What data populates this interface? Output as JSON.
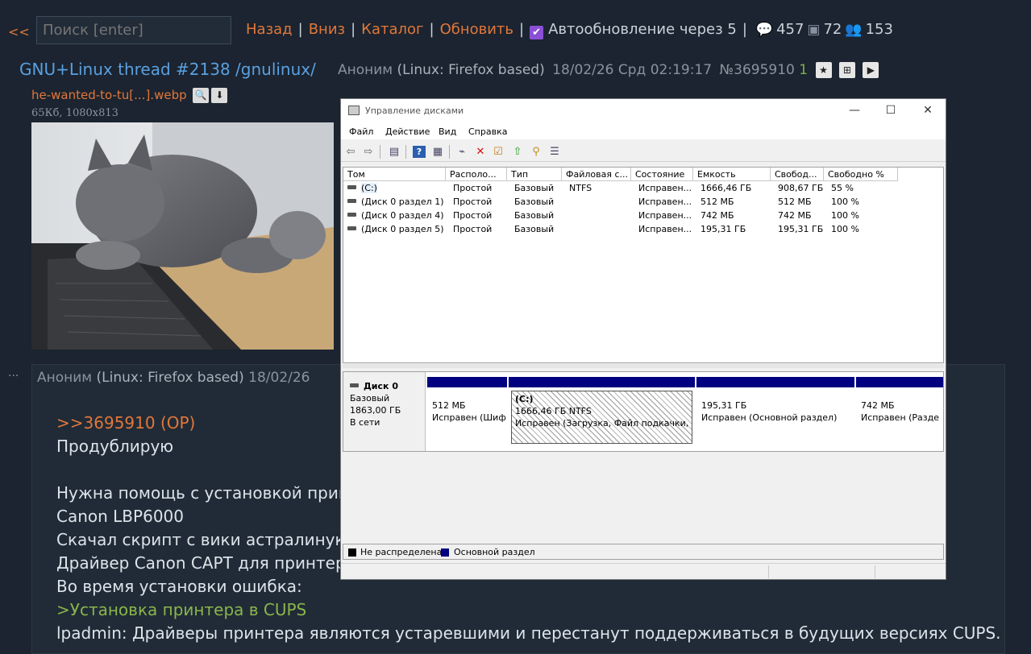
{
  "topbar": {
    "back": "<<",
    "search_placeholder": "Поиск [enter]",
    "links": [
      "Назад",
      "Вниз",
      "Каталог",
      "Обновить"
    ],
    "separator": "|",
    "autoupdate_label": "Автообновление через 5",
    "autoupdate_checked": true,
    "stats": {
      "posts": "457",
      "images": "72",
      "posters": "153"
    }
  },
  "post": {
    "title": "GNU+Linux thread #2138 /gnulinux/",
    "author": "Аноним",
    "os": "(Linux: Firefox based)",
    "date": "18/02/26 Срд 02:19:17",
    "number": "№3695910",
    "replies": "1",
    "file": {
      "name": "he-wanted-to-tu[...].webp",
      "info": "65Кб, 1080x813"
    }
  },
  "reply": {
    "dots": "...",
    "author": "Аноним",
    "os": "(Linux: Firefox based)",
    "date": "18/02/26",
    "lines": [
      {
        "text": ">>3695910 (OP)",
        "kind": "quote"
      },
      {
        "text": "Продублирую",
        "kind": "text"
      },
      {
        "text": "",
        "kind": "text"
      },
      {
        "text": "Нужна помощь с установкой прин",
        "kind": "text"
      },
      {
        "text": "Canon LBP6000",
        "kind": "text"
      },
      {
        "text": "Скачал скрипт с вики астралинукс",
        "kind": "text"
      },
      {
        "text": "Драйвер Canon CAPT для принтер",
        "kind": "text"
      },
      {
        "text": "Во время установки ошибка:",
        "kind": "text"
      },
      {
        "text": ">Установка принтера в CUPS",
        "kind": "green"
      },
      {
        "text": "lpadmin: Драйверы принтера являются устаревшими и перестанут поддерживаться в будущих версиях CUPS.",
        "kind": "text"
      }
    ]
  },
  "window": {
    "title": "Управление дисками",
    "menu": [
      "Файл",
      "Действие",
      "Вид",
      "Справка"
    ],
    "columns": [
      "Том",
      "Располо...",
      "Тип",
      "Файловая с...",
      "Состояние",
      "Емкость",
      "Свобод...",
      "Свободно %"
    ],
    "volumes": [
      [
        "(C:)",
        "Простой",
        "Базовый",
        "NTFS",
        "Исправен...",
        "1666,46 ГБ",
        "908,67 ГБ",
        "55 %"
      ],
      [
        "(Диск 0 раздел 1)",
        "Простой",
        "Базовый",
        "",
        "Исправен...",
        "512 МБ",
        "512 МБ",
        "100 %"
      ],
      [
        "(Диск 0 раздел 4)",
        "Простой",
        "Базовый",
        "",
        "Исправен...",
        "742 МБ",
        "742 МБ",
        "100 %"
      ],
      [
        "(Диск 0 раздел 5)",
        "Простой",
        "Базовый",
        "",
        "Исправен...",
        "195,31 ГБ",
        "195,31 ГБ",
        "100 %"
      ]
    ],
    "disk": {
      "name": "Диск 0",
      "type": "Базовый",
      "size": "1863,00 ГБ",
      "status": "В сети",
      "partitions": [
        {
          "label": "",
          "size": "512 МБ",
          "status": "Исправен (Шиф"
        },
        {
          "label": "(C:)",
          "size": "1666,46 ГБ NTFS",
          "status": "Исправен (Загрузка, Файл подкачки, Ав"
        },
        {
          "label": "",
          "size": "195,31 ГБ",
          "status": "Исправен (Основной раздел)"
        },
        {
          "label": "",
          "size": "742 МБ",
          "status": "Исправен (Разде"
        }
      ]
    },
    "legend": {
      "unallocated": "Не распределена",
      "primary": "Основной раздел"
    }
  },
  "colors": {
    "bg": "#1b2430",
    "accent": "#e2773a",
    "link_blue": "#5aa0e0",
    "greentext": "#8bb54a",
    "partition_bar": "#000080"
  }
}
